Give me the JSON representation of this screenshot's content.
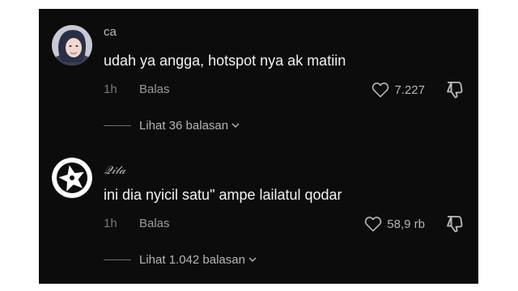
{
  "comments": [
    {
      "username": "ca",
      "text": "udah ya angga, hotspot nya ak matiin",
      "time": "1h",
      "reply_label": "Balas",
      "likes": "7.227",
      "view_replies": "Lihat 36 balasan",
      "avatar_icon": "photo-avatar"
    },
    {
      "username": "𝒬𝒾𝓁𝒶",
      "text": "ini dia nyicil satu\" ampe lailatul qodar",
      "time": "1h",
      "reply_label": "Balas",
      "likes": "58,9 rb",
      "view_replies": "Lihat 1.042 balasan",
      "avatar_icon": "star-logo-avatar"
    }
  ],
  "colors": {
    "background": "#0c0c0c",
    "text": "#f2f2f2",
    "muted": "#7a7a7a"
  },
  "icons": [
    "heart-icon",
    "thumbs-down-icon",
    "chevron-down-icon"
  ]
}
